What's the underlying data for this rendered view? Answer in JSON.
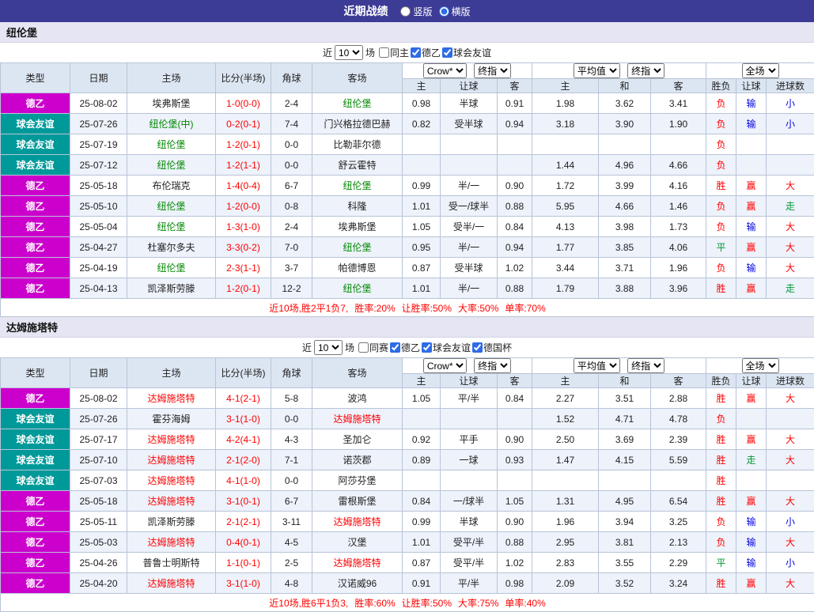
{
  "topbar": {
    "title": "近期战绩",
    "layout_options": [
      {
        "label": "竖版",
        "selected": false
      },
      {
        "label": "横版",
        "selected": true
      }
    ]
  },
  "filter_controls": {
    "prefix": "近",
    "count": "10",
    "suffix": "场"
  },
  "table_header": {
    "col_type": "类型",
    "col_date": "日期",
    "col_home": "主场",
    "col_score": "比分(半场)",
    "col_corner": "角球",
    "col_away": "客场",
    "odds_source_select": "Crow*",
    "odds_final_select": "终指",
    "avg_select": "平均值",
    "avg_final_select": "终指",
    "fulltime_select": "全场",
    "sub_home": "主",
    "sub_handicap": "让球",
    "sub_away": "客",
    "sub_home2": "主",
    "sub_draw": "和",
    "sub_away2": "客",
    "sub_result": "胜负",
    "sub_handicap2": "让球",
    "sub_goals": "进球数"
  },
  "palette": {
    "league_type": "#cc00cc",
    "friendly_type": "#009999",
    "section1_team": "#008800",
    "section2_team": "#ff0000",
    "win_red": "#ff0000",
    "lose_blue": "#0000e0",
    "push_green": "#009933",
    "topbar_bg": "#3c3b96"
  },
  "sections": [
    {
      "team": "纽伦堡",
      "focus_color": "#008800",
      "filters": [
        {
          "label": "同主",
          "checked": false
        },
        {
          "label": "德乙",
          "checked": true
        },
        {
          "label": "球会友谊",
          "checked": true
        }
      ],
      "rows": [
        {
          "type": "德乙",
          "type_color": "league",
          "date": "25-08-02",
          "home": "埃弗斯堡",
          "home_focus": false,
          "score": "1-0(0-0)",
          "corner": "2-4",
          "away": "纽伦堡",
          "away_focus": true,
          "odds_home": "0.98",
          "handicap": "半球",
          "odds_away": "0.91",
          "avg_home": "1.98",
          "avg_draw": "3.62",
          "avg_away": "3.41",
          "result": "负",
          "result_color": "red",
          "handicap_result": "输",
          "handicap_result_color": "blue",
          "goals": "小",
          "goals_color": "blue"
        },
        {
          "type": "球会友谊",
          "type_color": "friendly",
          "date": "25-07-26",
          "home": "纽伦堡(中)",
          "home_focus": true,
          "score": "0-2(0-1)",
          "corner": "7-4",
          "away": "门兴格拉德巴赫",
          "away_focus": false,
          "odds_home": "0.82",
          "handicap": "受半球",
          "odds_away": "0.94",
          "avg_home": "3.18",
          "avg_draw": "3.90",
          "avg_away": "1.90",
          "result": "负",
          "result_color": "red",
          "handicap_result": "输",
          "handicap_result_color": "blue",
          "goals": "小",
          "goals_color": "blue"
        },
        {
          "type": "球会友谊",
          "type_color": "friendly",
          "date": "25-07-19",
          "home": "纽伦堡",
          "home_focus": true,
          "score": "1-2(0-1)",
          "corner": "0-0",
          "away": "比勒菲尔德",
          "away_focus": false,
          "odds_home": "",
          "handicap": "",
          "odds_away": "",
          "avg_home": "",
          "avg_draw": "",
          "avg_away": "",
          "result": "负",
          "result_color": "red",
          "handicap_result": "",
          "handicap_result_color": "",
          "goals": "",
          "goals_color": ""
        },
        {
          "type": "球会友谊",
          "type_color": "friendly",
          "date": "25-07-12",
          "home": "纽伦堡",
          "home_focus": true,
          "score": "1-2(1-1)",
          "corner": "0-0",
          "away": "舒云霍特",
          "away_focus": false,
          "odds_home": "",
          "handicap": "",
          "odds_away": "",
          "avg_home": "1.44",
          "avg_draw": "4.96",
          "avg_away": "4.66",
          "result": "负",
          "result_color": "red",
          "handicap_result": "",
          "handicap_result_color": "",
          "goals": "",
          "goals_color": ""
        },
        {
          "type": "德乙",
          "type_color": "league",
          "date": "25-05-18",
          "home": "布伦瑞克",
          "home_focus": false,
          "score": "1-4(0-4)",
          "corner": "6-7",
          "away": "纽伦堡",
          "away_focus": true,
          "odds_home": "0.99",
          "handicap": "半/一",
          "odds_away": "0.90",
          "avg_home": "1.72",
          "avg_draw": "3.99",
          "avg_away": "4.16",
          "result": "胜",
          "result_color": "red",
          "handicap_result": "赢",
          "handicap_result_color": "red",
          "goals": "大",
          "goals_color": "red"
        },
        {
          "type": "德乙",
          "type_color": "league",
          "date": "25-05-10",
          "home": "纽伦堡",
          "home_focus": true,
          "score": "1-2(0-0)",
          "corner": "0-8",
          "away": "科隆",
          "away_focus": false,
          "odds_home": "1.01",
          "handicap": "受一/球半",
          "odds_away": "0.88",
          "avg_home": "5.95",
          "avg_draw": "4.66",
          "avg_away": "1.46",
          "result": "负",
          "result_color": "red",
          "handicap_result": "赢",
          "handicap_result_color": "red",
          "goals": "走",
          "goals_color": "green"
        },
        {
          "type": "德乙",
          "type_color": "league",
          "date": "25-05-04",
          "home": "纽伦堡",
          "home_focus": true,
          "score": "1-3(1-0)",
          "corner": "2-4",
          "away": "埃弗斯堡",
          "away_focus": false,
          "odds_home": "1.05",
          "handicap": "受半/一",
          "odds_away": "0.84",
          "avg_home": "4.13",
          "avg_draw": "3.98",
          "avg_away": "1.73",
          "result": "负",
          "result_color": "red",
          "handicap_result": "输",
          "handicap_result_color": "blue",
          "goals": "大",
          "goals_color": "red"
        },
        {
          "type": "德乙",
          "type_color": "league",
          "date": "25-04-27",
          "home": "杜塞尔多夫",
          "home_focus": false,
          "score": "3-3(0-2)",
          "corner": "7-0",
          "away": "纽伦堡",
          "away_focus": true,
          "odds_home": "0.95",
          "handicap": "半/一",
          "odds_away": "0.94",
          "avg_home": "1.77",
          "avg_draw": "3.85",
          "avg_away": "4.06",
          "result": "平",
          "result_color": "green",
          "handicap_result": "赢",
          "handicap_result_color": "red",
          "goals": "大",
          "goals_color": "red"
        },
        {
          "type": "德乙",
          "type_color": "league",
          "date": "25-04-19",
          "home": "纽伦堡",
          "home_focus": true,
          "score": "2-3(1-1)",
          "corner": "3-7",
          "away": "帕德博恩",
          "away_focus": false,
          "odds_home": "0.87",
          "handicap": "受半球",
          "odds_away": "1.02",
          "avg_home": "3.44",
          "avg_draw": "3.71",
          "avg_away": "1.96",
          "result": "负",
          "result_color": "red",
          "handicap_result": "输",
          "handicap_result_color": "blue",
          "goals": "大",
          "goals_color": "red"
        },
        {
          "type": "德乙",
          "type_color": "league",
          "date": "25-04-13",
          "home": "凯泽斯劳滕",
          "home_focus": false,
          "score": "1-2(0-1)",
          "corner": "12-2",
          "away": "纽伦堡",
          "away_focus": true,
          "odds_home": "1.01",
          "handicap": "半/一",
          "odds_away": "0.88",
          "avg_home": "1.79",
          "avg_draw": "3.88",
          "avg_away": "3.96",
          "result": "胜",
          "result_color": "red",
          "handicap_result": "赢",
          "handicap_result_color": "red",
          "goals": "走",
          "goals_color": "green"
        }
      ],
      "summary": {
        "record": "近10场,胜2平1负7,",
        "stats": [
          "胜率:20%",
          "让胜率:50%",
          "大率:50%",
          "单率:70%"
        ]
      }
    },
    {
      "team": "达姆施塔特",
      "focus_color": "#ff0000",
      "filters": [
        {
          "label": "同赛",
          "checked": false
        },
        {
          "label": "德乙",
          "checked": true
        },
        {
          "label": "球会友谊",
          "checked": true
        },
        {
          "label": "德国杯",
          "checked": true
        }
      ],
      "rows": [
        {
          "type": "德乙",
          "type_color": "league",
          "date": "25-08-02",
          "home": "达姆施塔特",
          "home_focus": true,
          "score": "4-1(2-1)",
          "corner": "5-8",
          "away": "波鸿",
          "away_focus": false,
          "odds_home": "1.05",
          "handicap": "平/半",
          "odds_away": "0.84",
          "avg_home": "2.27",
          "avg_draw": "3.51",
          "avg_away": "2.88",
          "result": "胜",
          "result_color": "red",
          "handicap_result": "赢",
          "handicap_result_color": "red",
          "goals": "大",
          "goals_color": "red"
        },
        {
          "type": "球会友谊",
          "type_color": "friendly",
          "date": "25-07-26",
          "home": "霍芬海姆",
          "home_focus": false,
          "score": "3-1(1-0)",
          "corner": "0-0",
          "away": "达姆施塔特",
          "away_focus": true,
          "odds_home": "",
          "handicap": "",
          "odds_away": "",
          "avg_home": "1.52",
          "avg_draw": "4.71",
          "avg_away": "4.78",
          "result": "负",
          "result_color": "red",
          "handicap_result": "",
          "handicap_result_color": "",
          "goals": "",
          "goals_color": ""
        },
        {
          "type": "球会友谊",
          "type_color": "friendly",
          "date": "25-07-17",
          "home": "达姆施塔特",
          "home_focus": true,
          "score": "4-2(4-1)",
          "corner": "4-3",
          "away": "圣加仑",
          "away_focus": false,
          "odds_home": "0.92",
          "handicap": "平手",
          "odds_away": "0.90",
          "avg_home": "2.50",
          "avg_draw": "3.69",
          "avg_away": "2.39",
          "result": "胜",
          "result_color": "red",
          "handicap_result": "赢",
          "handicap_result_color": "red",
          "goals": "大",
          "goals_color": "red"
        },
        {
          "type": "球会友谊",
          "type_color": "friendly",
          "date": "25-07-10",
          "home": "达姆施塔特",
          "home_focus": true,
          "score": "2-1(2-0)",
          "corner": "7-1",
          "away": "诺茨郡",
          "away_focus": false,
          "odds_home": "0.89",
          "handicap": "一球",
          "odds_away": "0.93",
          "avg_home": "1.47",
          "avg_draw": "4.15",
          "avg_away": "5.59",
          "result": "胜",
          "result_color": "red",
          "handicap_result": "走",
          "handicap_result_color": "green",
          "goals": "大",
          "goals_color": "red"
        },
        {
          "type": "球会友谊",
          "type_color": "friendly",
          "date": "25-07-03",
          "home": "达姆施塔特",
          "home_focus": true,
          "score": "4-1(1-0)",
          "corner": "0-0",
          "away": "阿莎芬堡",
          "away_focus": false,
          "odds_home": "",
          "handicap": "",
          "odds_away": "",
          "avg_home": "",
          "avg_draw": "",
          "avg_away": "",
          "result": "胜",
          "result_color": "red",
          "handicap_result": "",
          "handicap_result_color": "",
          "goals": "",
          "goals_color": ""
        },
        {
          "type": "德乙",
          "type_color": "league",
          "date": "25-05-18",
          "home": "达姆施塔特",
          "home_focus": true,
          "score": "3-1(0-1)",
          "corner": "6-7",
          "away": "雷根斯堡",
          "away_focus": false,
          "odds_home": "0.84",
          "handicap": "一/球半",
          "odds_away": "1.05",
          "avg_home": "1.31",
          "avg_draw": "4.95",
          "avg_away": "6.54",
          "result": "胜",
          "result_color": "red",
          "handicap_result": "赢",
          "handicap_result_color": "red",
          "goals": "大",
          "goals_color": "red"
        },
        {
          "type": "德乙",
          "type_color": "league",
          "date": "25-05-11",
          "home": "凯泽斯劳滕",
          "home_focus": false,
          "score": "2-1(2-1)",
          "corner": "3-11",
          "away": "达姆施塔特",
          "away_focus": true,
          "odds_home": "0.99",
          "handicap": "半球",
          "odds_away": "0.90",
          "avg_home": "1.96",
          "avg_draw": "3.94",
          "avg_away": "3.25",
          "result": "负",
          "result_color": "red",
          "handicap_result": "输",
          "handicap_result_color": "blue",
          "goals": "小",
          "goals_color": "blue"
        },
        {
          "type": "德乙",
          "type_color": "league",
          "date": "25-05-03",
          "home": "达姆施塔特",
          "home_focus": true,
          "score": "0-4(0-1)",
          "corner": "4-5",
          "away": "汉堡",
          "away_focus": false,
          "odds_home": "1.01",
          "handicap": "受平/半",
          "odds_away": "0.88",
          "avg_home": "2.95",
          "avg_draw": "3.81",
          "avg_away": "2.13",
          "result": "负",
          "result_color": "red",
          "handicap_result": "输",
          "handicap_result_color": "blue",
          "goals": "大",
          "goals_color": "red"
        },
        {
          "type": "德乙",
          "type_color": "league",
          "date": "25-04-26",
          "home": "普鲁士明斯特",
          "home_focus": false,
          "score": "1-1(0-1)",
          "corner": "2-5",
          "away": "达姆施塔特",
          "away_focus": true,
          "odds_home": "0.87",
          "handicap": "受平/半",
          "odds_away": "1.02",
          "avg_home": "2.83",
          "avg_draw": "3.55",
          "avg_away": "2.29",
          "result": "平",
          "result_color": "green",
          "handicap_result": "输",
          "handicap_result_color": "blue",
          "goals": "小",
          "goals_color": "blue"
        },
        {
          "type": "德乙",
          "type_color": "league",
          "date": "25-04-20",
          "home": "达姆施塔特",
          "home_focus": true,
          "score": "3-1(1-0)",
          "corner": "4-8",
          "away": "汉诺威96",
          "away_focus": false,
          "odds_home": "0.91",
          "handicap": "平/半",
          "odds_away": "0.98",
          "avg_home": "2.09",
          "avg_draw": "3.52",
          "avg_away": "3.24",
          "result": "胜",
          "result_color": "red",
          "handicap_result": "赢",
          "handicap_result_color": "red",
          "goals": "大",
          "goals_color": "red"
        }
      ],
      "summary": {
        "record": "近10场,胜6平1负3,",
        "stats": [
          "胜率:60%",
          "让胜率:50%",
          "大率:75%",
          "单率:40%"
        ]
      }
    }
  ]
}
